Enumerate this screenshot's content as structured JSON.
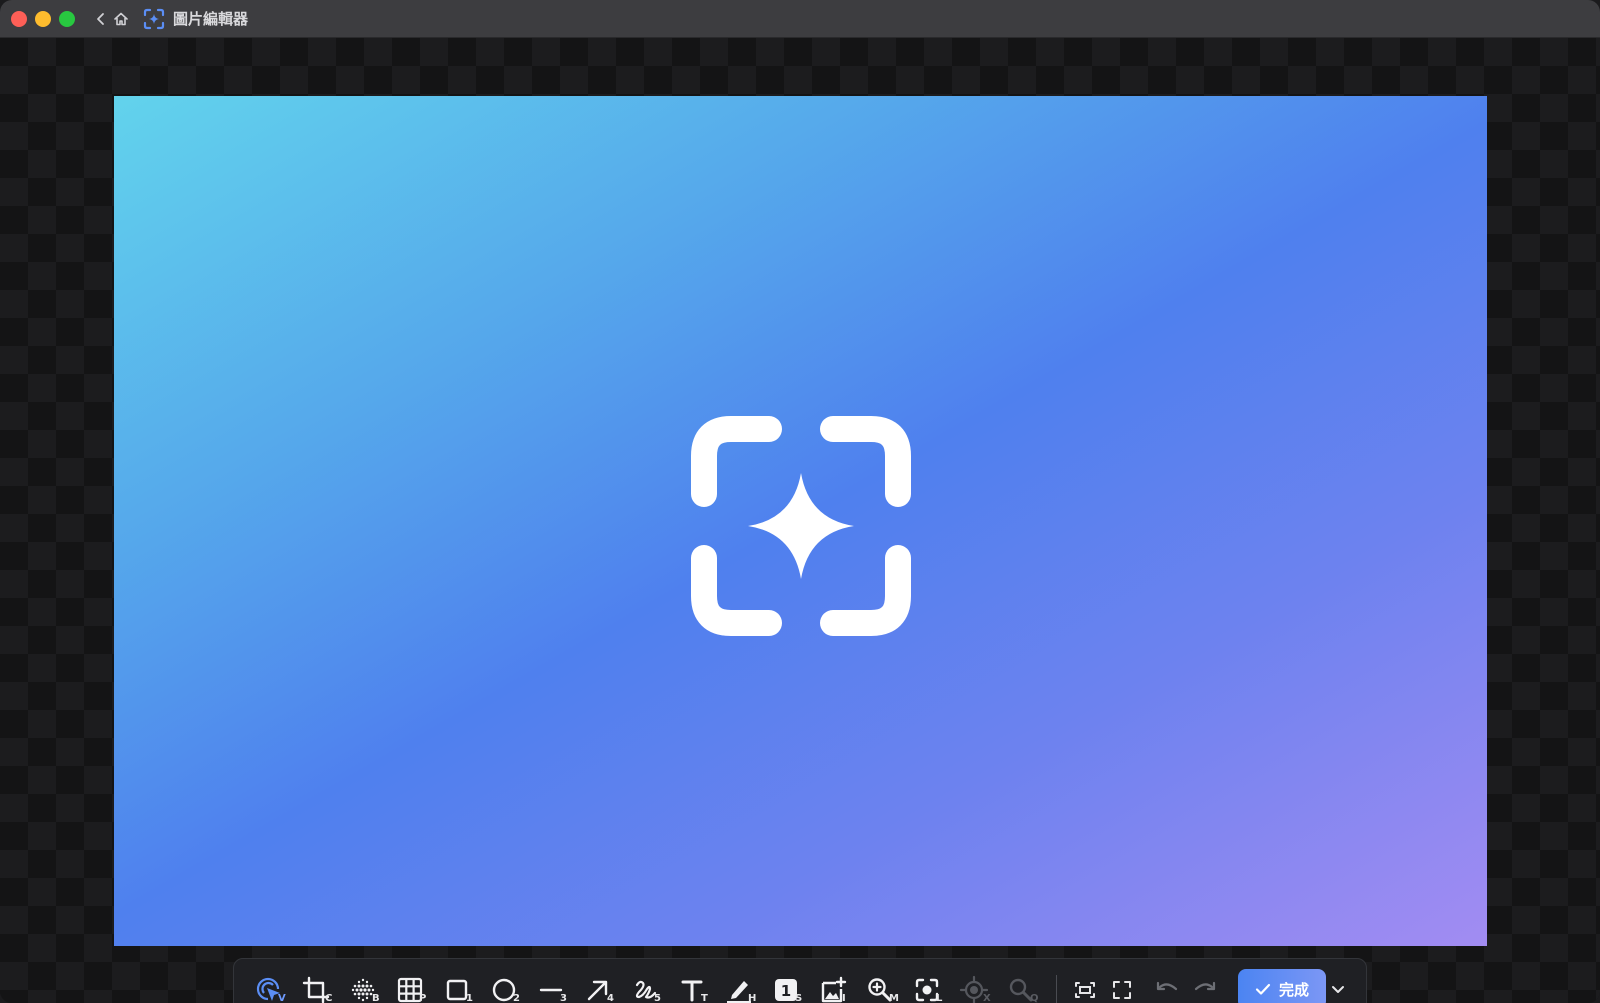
{
  "window": {
    "title": "圖片編輯器"
  },
  "toolbar": {
    "tools": [
      {
        "name": "select",
        "key": "V"
      },
      {
        "name": "crop",
        "key": "C"
      },
      {
        "name": "blur",
        "key": "B"
      },
      {
        "name": "pixelate",
        "key": "P"
      },
      {
        "name": "rectangle",
        "key": "1"
      },
      {
        "name": "ellipse",
        "key": "2"
      },
      {
        "name": "line",
        "key": "3"
      },
      {
        "name": "arrow",
        "key": "4"
      },
      {
        "name": "freehand",
        "key": "5"
      },
      {
        "name": "text",
        "key": "T"
      },
      {
        "name": "highlighter",
        "key": "H"
      },
      {
        "name": "step-counter",
        "key": "S",
        "glyph": "1"
      },
      {
        "name": "insert-image",
        "key": "I"
      },
      {
        "name": "magnifier",
        "key": "M"
      },
      {
        "name": "spotlight",
        "key": "L"
      },
      {
        "name": "target",
        "key": "X"
      },
      {
        "name": "search",
        "key": "Q"
      }
    ],
    "done_label": "完成"
  },
  "colors": {
    "accent": "#4b84f2",
    "titlebar": "#3d3d40",
    "toolbar_bg": "#1f2024"
  }
}
